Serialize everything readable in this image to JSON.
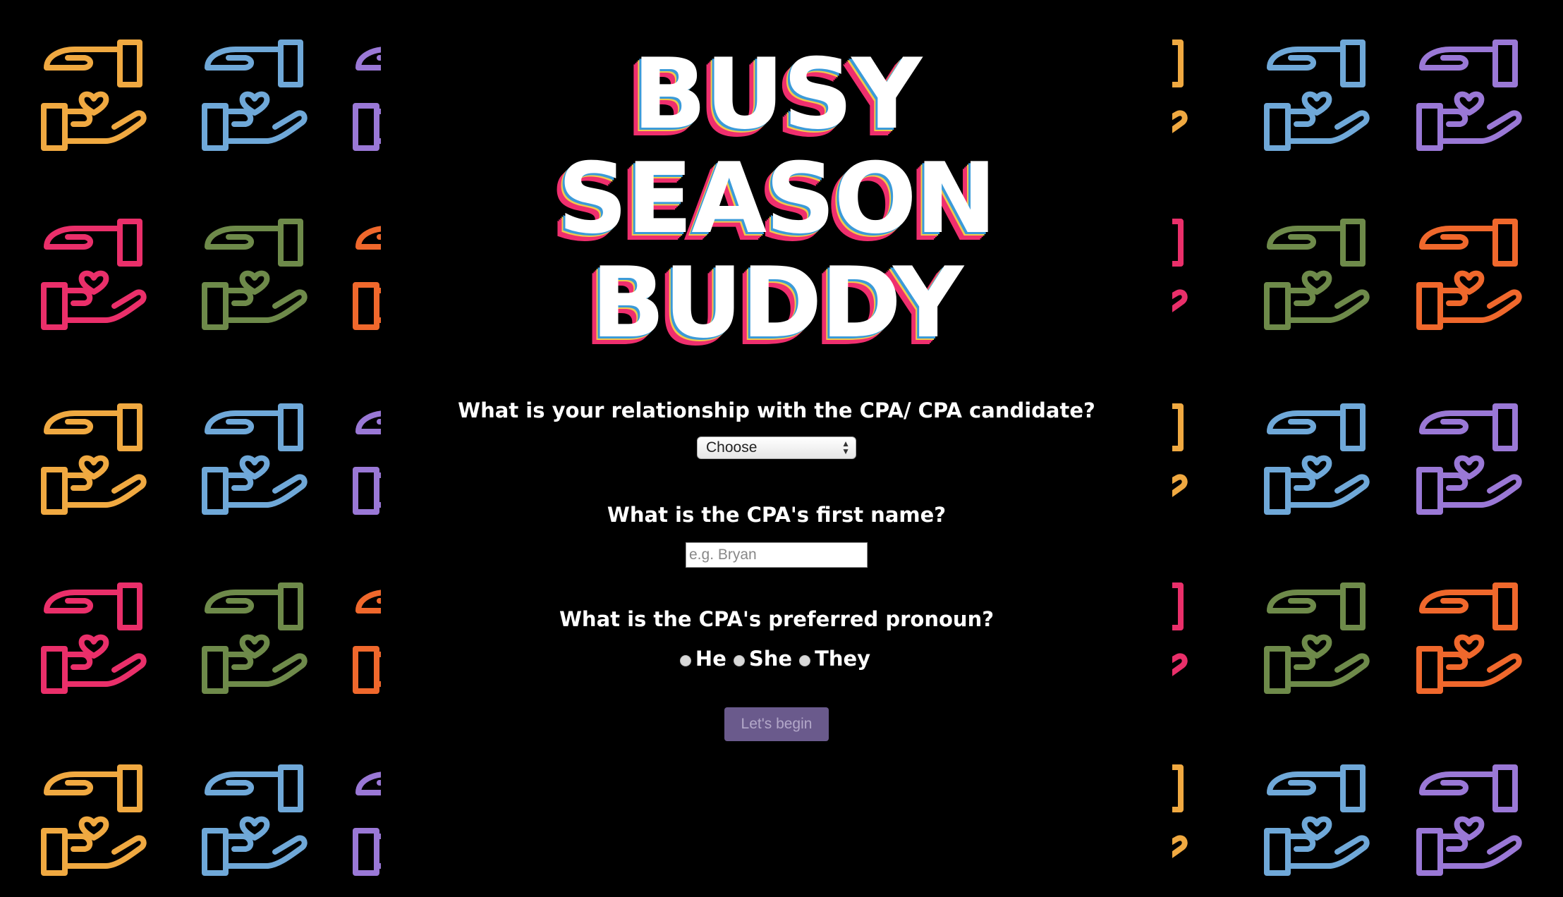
{
  "logo": {
    "line1": "BUSY",
    "line2": "SEASON",
    "line3": "BUDDY"
  },
  "questions": {
    "relationship": "What is your relationship with the CPA/ CPA candidate?",
    "first_name": "What is the CPA's first name?",
    "pronoun": "What is the CPA's preferred pronoun?"
  },
  "relationship_select": {
    "selected": "Choose"
  },
  "first_name_input": {
    "placeholder": "e.g. Bryan",
    "value": ""
  },
  "pronoun_options": [
    "He",
    "She",
    "They"
  ],
  "begin_button": "Let's begin",
  "icon": "hand-heart-icon",
  "colors": {
    "background": "#000000",
    "icon_orange": "#f0a941",
    "icon_blue": "#6fa8d8",
    "icon_purple": "#9a78d6",
    "icon_pink": "#ea2f6a",
    "icon_green": "#6e8a4a",
    "icon_red_orange": "#f0682c",
    "logo_pink": "#ef2f6e",
    "logo_yellow": "#f2c94c",
    "logo_blue": "#3b9bd9",
    "button_bg": "#6a5a8c",
    "button_text": "#b3a8c9"
  }
}
